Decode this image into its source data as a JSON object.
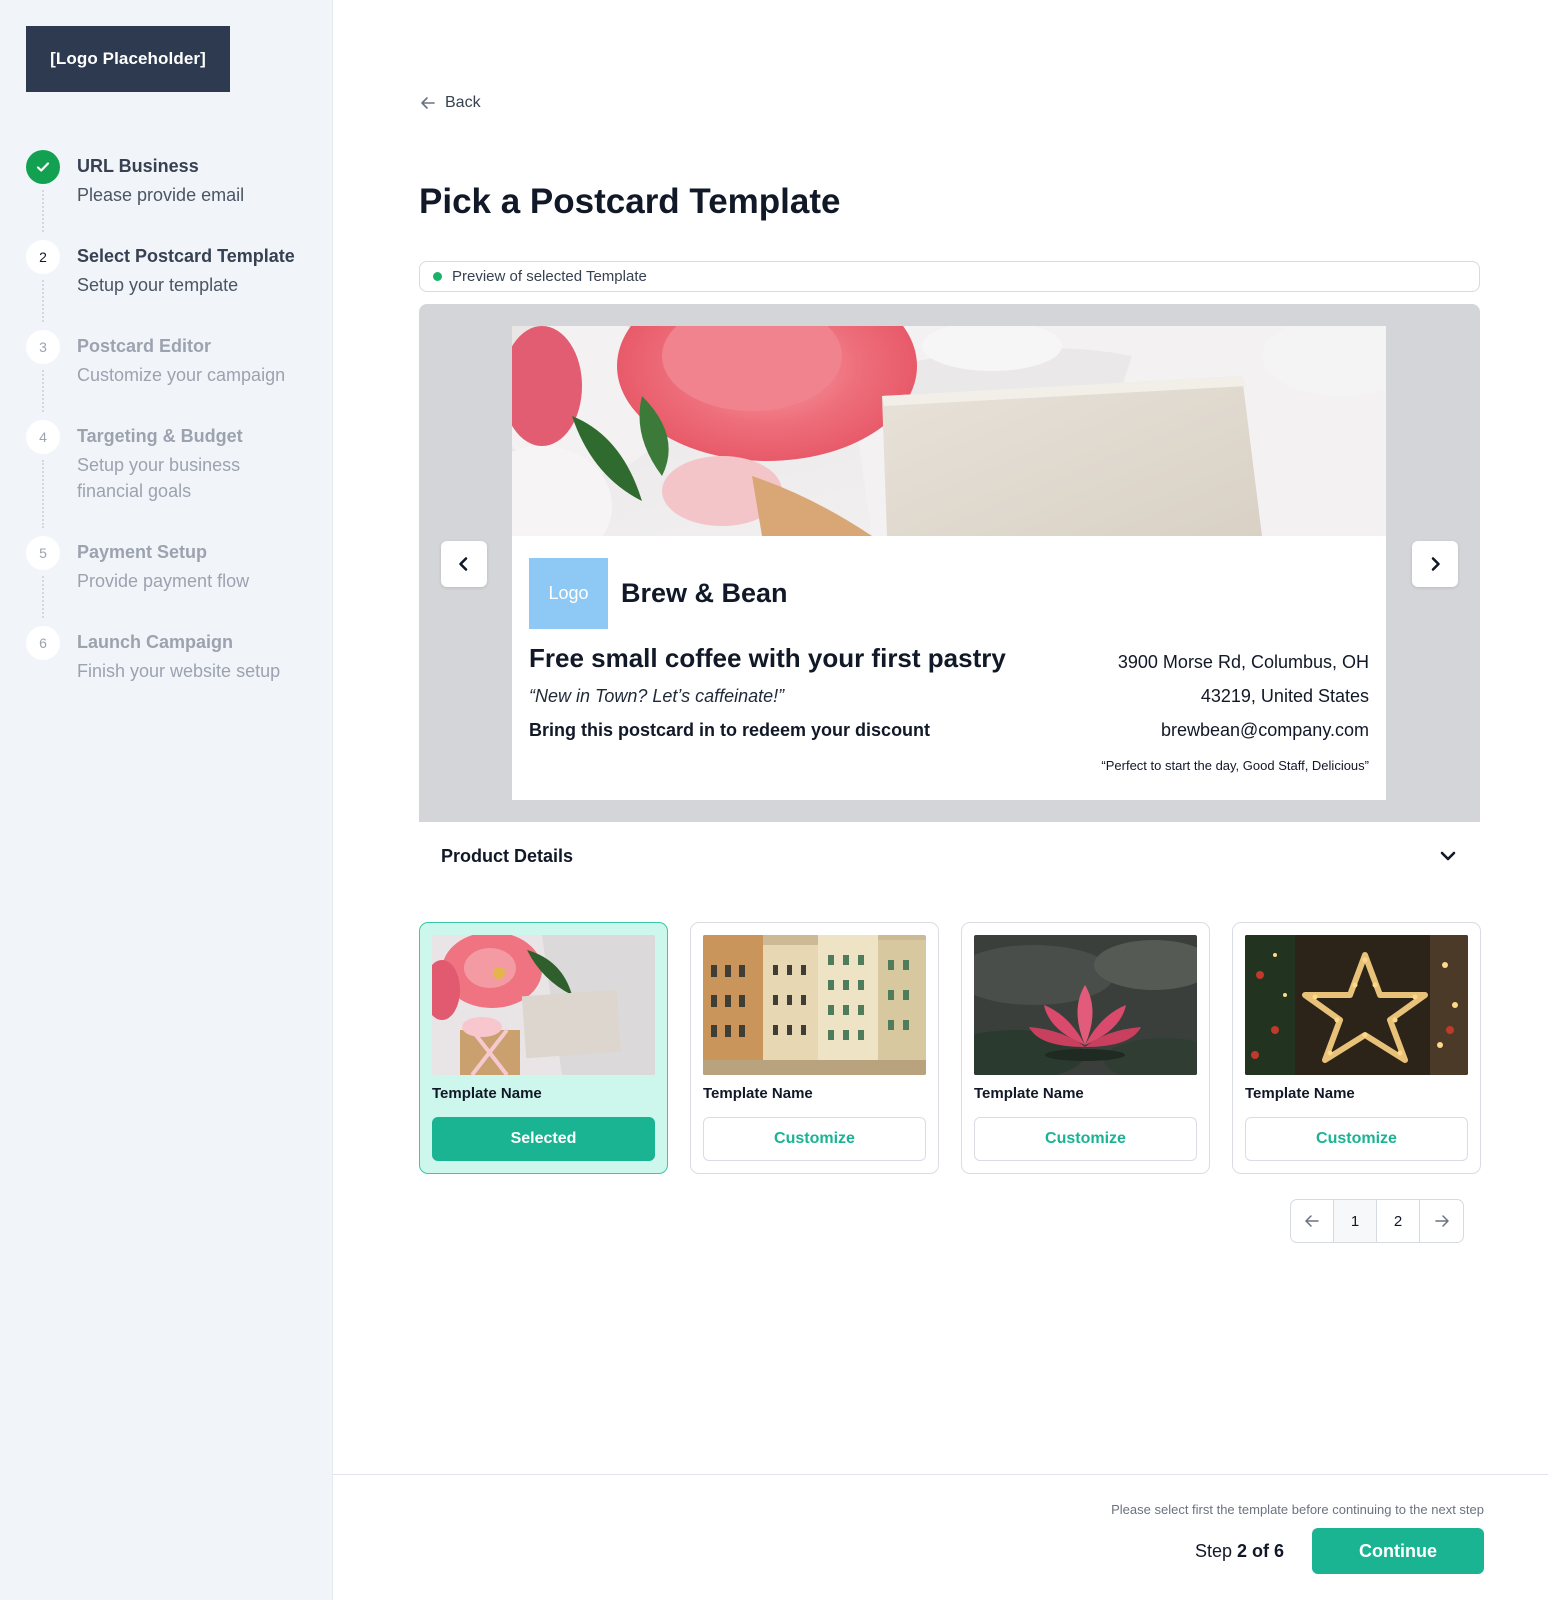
{
  "sidebar": {
    "logo": "[Logo Placeholder]",
    "steps": [
      {
        "number": "",
        "title": "URL Business",
        "subtitle": "Please provide email"
      },
      {
        "number": "2",
        "title": "Select Postcard Template",
        "subtitle": "Setup your template"
      },
      {
        "number": "3",
        "title": "Postcard Editor",
        "subtitle": "Customize your campaign"
      },
      {
        "number": "4",
        "title": "Targeting & Budget",
        "subtitle": "Setup your business financial goals"
      },
      {
        "number": "5",
        "title": "Payment Setup",
        "subtitle": "Provide payment flow"
      },
      {
        "number": "6",
        "title": "Launch Campaign",
        "subtitle": "Finish your website setup"
      }
    ]
  },
  "main": {
    "back_label": "Back",
    "title": "Pick a Postcard Template",
    "preview_label": "Preview of selected Template",
    "postcard": {
      "logo": "Logo",
      "brand": "Brew & Bean",
      "headline": "Free small coffee with your first pastry",
      "tagline": "“New in Town? Let’s caffeinate!”",
      "cta": "Bring this postcard in to redeem your discount",
      "address_line1": "3900 Morse Rd, Columbus, OH",
      "address_line2": "43219, United States",
      "email": "brewbean@company.com",
      "review": "“Perfect to start the day, Good Staff, Delicious”"
    },
    "details_label": "Product Details",
    "templates": [
      {
        "name": "Template Name",
        "button": "Selected",
        "selected": true
      },
      {
        "name": "Template Name",
        "button": "Customize",
        "selected": false
      },
      {
        "name": "Template Name",
        "button": "Customize",
        "selected": false
      },
      {
        "name": "Template Name",
        "button": "Customize",
        "selected": false
      }
    ],
    "pagination": {
      "pages": [
        "1",
        "2"
      ],
      "current": "1"
    }
  },
  "footer": {
    "note": "Please select first the template before continuing to the next step",
    "step_prefix": "Step",
    "step_value": "2 of 6",
    "continue_label": "Continue"
  },
  "colors": {
    "accent": "#1bb493",
    "done": "#12a150",
    "logo_bg": "#2e3a4f",
    "selected_card_bg": "#cdf6ec"
  }
}
